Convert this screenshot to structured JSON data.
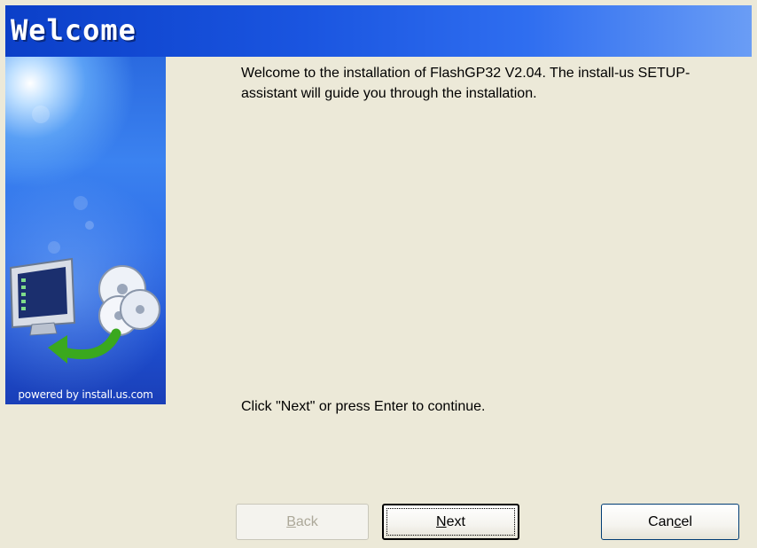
{
  "window": {
    "title": "Welcome"
  },
  "side_panel": {
    "powered_by": "powered by install.us.com",
    "illustration": "monitor-and-discs-icon"
  },
  "content": {
    "intro": "Welcome to the installation of FlashGP32 V2.04. The install-us SETUP-assistant will guide you through the installation.",
    "continue_hint": "Click \"Next\" or press Enter to continue."
  },
  "buttons": {
    "back": {
      "prefix": "",
      "mnemonic": "B",
      "suffix": "ack",
      "enabled": false
    },
    "next": {
      "prefix": "",
      "mnemonic": "N",
      "suffix": "ext",
      "enabled": true
    },
    "cancel": {
      "prefix": "Can",
      "mnemonic": "c",
      "suffix": "el",
      "enabled": true
    }
  },
  "colors": {
    "title_bar": "#1a55e0",
    "dialog_bg": "#ece9d8",
    "panel_blue": "#2f6fe8"
  }
}
